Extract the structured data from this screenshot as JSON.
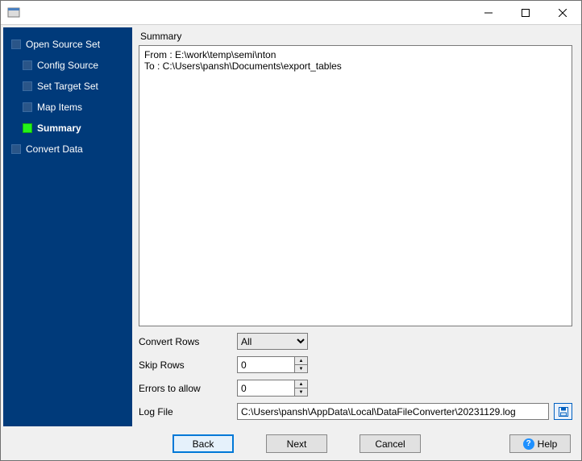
{
  "sidebar": {
    "steps": [
      {
        "label": "Open Source Set"
      },
      {
        "label": "Config Source"
      },
      {
        "label": "Set Target Set"
      },
      {
        "label": "Map Items"
      },
      {
        "label": "Summary"
      },
      {
        "label": "Convert Data"
      }
    ]
  },
  "content": {
    "section_title": "Summary",
    "summary_lines": {
      "from": "From : E:\\work\\temp\\semi\\nton",
      "to": "To : C:\\Users\\pansh\\Documents\\export_tables"
    },
    "convert_rows": {
      "label": "Convert Rows",
      "value": "All"
    },
    "skip_rows": {
      "label": "Skip Rows",
      "value": "0"
    },
    "errors": {
      "label": "Errors to allow",
      "value": "0"
    },
    "log_file": {
      "label": "Log File",
      "value": "C:\\Users\\pansh\\AppData\\Local\\DataFileConverter\\20231129.log"
    }
  },
  "buttons": {
    "back": "Back",
    "next": "Next",
    "cancel": "Cancel",
    "help": "Help"
  }
}
